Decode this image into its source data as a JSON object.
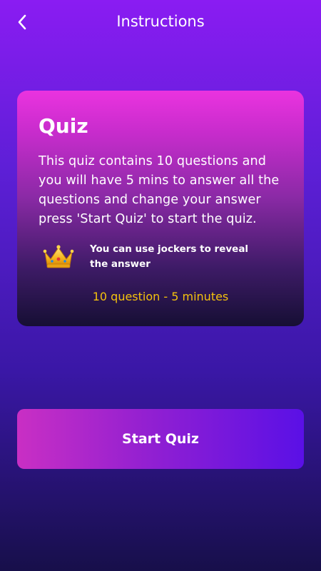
{
  "header": {
    "title": "Instructions",
    "back_icon": "chevron-left-icon"
  },
  "card": {
    "title": "Quiz",
    "body": "This quiz contains 10 questions and you will have 5 mins to answer all the questions and change your answer press 'Start Quiz' to start the quiz.",
    "joker_icon": "crown-icon",
    "joker_text": "You can use jockers to reveal the answer",
    "meta": "10 question - 5 minutes"
  },
  "start_button": {
    "label": "Start Quiz"
  },
  "colors": {
    "background_top": "#8a1cf2",
    "background_bottom": "#170f4a",
    "card_top": "#ea33df",
    "card_bottom": "#160f34",
    "meta_text": "#f4c20d",
    "button_left": "#c92fc4",
    "button_right": "#5a10e6"
  }
}
